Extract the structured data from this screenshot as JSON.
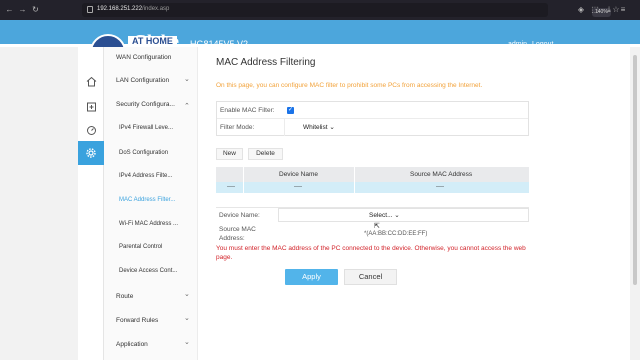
{
  "browser": {
    "url_host": "192.168.251.222",
    "url_path": "/index.asp",
    "zoom": "140%"
  },
  "header": {
    "logo_text": "Globe",
    "logo_sub": "AT HOME",
    "model": "HG8145V5 V2",
    "admin_link": "admin",
    "logout_link": "Logout",
    "color": "#4ca6dc"
  },
  "rail": {
    "icons": [
      "home-icon",
      "device-icon",
      "speed-icon",
      "gear-icon"
    ],
    "active": "gear-icon"
  },
  "menu": {
    "items": [
      {
        "label": "WAN Configuration"
      },
      {
        "label": "LAN Configuration",
        "chevron": "⌄"
      },
      {
        "label": "Security Configura...",
        "chevron": "⌃"
      },
      {
        "label": "IPv4 Firewall Leve..."
      },
      {
        "label": "DoS Configuration"
      },
      {
        "label": "IPv4 Address Filte..."
      },
      {
        "label": "MAC Address Filter..."
      },
      {
        "label": "Wi-Fi MAC Address ..."
      },
      {
        "label": "Parental Control"
      },
      {
        "label": "Device Access Cont..."
      },
      {
        "label": "Route",
        "chevron": "⌄"
      },
      {
        "label": "Forward Rules",
        "chevron": "⌄"
      },
      {
        "label": "Application",
        "chevron": "⌄"
      }
    ]
  },
  "main": {
    "title": "MAC Address Filtering",
    "intro": "On this page, you can configure MAC filter to prohibit some PCs from accessing the Internet.",
    "enable_label": "Enable MAC Filter:",
    "enable_checked": true,
    "filter_mode_label": "Filter Mode:",
    "filter_mode_value": "Whitelist",
    "new_button": "New",
    "delete_button": "Delete",
    "table": {
      "headers": [
        "Device Name",
        "Source MAC Address"
      ],
      "row": [
        "----",
        "----",
        "----"
      ]
    },
    "device_name_label": "Device Name:",
    "device_name_select": "Select...",
    "source_mac_label_1": "Source MAC",
    "source_mac_label_2": "Address:",
    "mac_hint": "*(AA:BB:CC:DD:EE:FF)",
    "warning": "You must enter the MAC address of the PC connected to the device. Otherwise, you cannot access the web page.",
    "apply_button": "Apply",
    "cancel_button": "Cancel",
    "accent": "#52b4ea",
    "warning_color": "#d2232a"
  }
}
